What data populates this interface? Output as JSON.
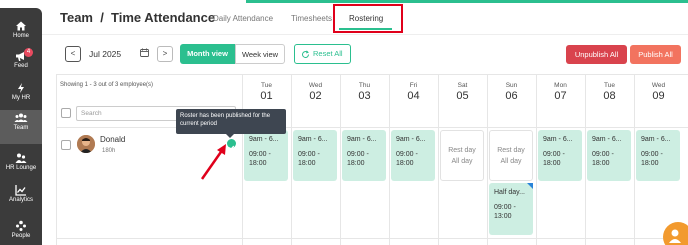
{
  "sidebar": {
    "items": [
      {
        "label": "Home",
        "icon": "home-icon"
      },
      {
        "label": "Feed",
        "icon": "megaphone-icon",
        "badge": "4"
      },
      {
        "label": "My HR",
        "icon": "lightning-icon"
      },
      {
        "label": "Team",
        "icon": "team-icon",
        "active": true
      },
      {
        "label": "HR Lounge",
        "icon": "lounge-icon"
      },
      {
        "label": "Analytics",
        "icon": "analytics-icon"
      },
      {
        "label": "People",
        "icon": "people-icon"
      }
    ]
  },
  "header": {
    "title": "Team  /  Time Attendance",
    "tabs": [
      {
        "label": "Daily Attendance"
      },
      {
        "label": "Timesheets"
      },
      {
        "label": "Rostering",
        "active": true
      }
    ]
  },
  "toolbar": {
    "prev": "<",
    "next": ">",
    "month": "Jul 2025",
    "month_view": "Month view",
    "week_view": "Week view",
    "reset_all": "Reset All",
    "unpublish_all": "Unpublish All",
    "publish_all": "Publish All"
  },
  "grid": {
    "showing": "Showing 1 - 3 out of 3 employee(s)",
    "search_placeholder": "Search",
    "days": [
      {
        "name": "Tue",
        "num": "01"
      },
      {
        "name": "Wed",
        "num": "02"
      },
      {
        "name": "Thu",
        "num": "03"
      },
      {
        "name": "Fri",
        "num": "04"
      },
      {
        "name": "Sat",
        "num": "05"
      },
      {
        "name": "Sun",
        "num": "06"
      },
      {
        "name": "Mon",
        "num": "07"
      },
      {
        "name": "Tue",
        "num": "08"
      },
      {
        "name": "Wed",
        "num": "09"
      }
    ],
    "employee": {
      "name": "Donald",
      "hours": "180h"
    },
    "shift_title": "9am - 6...",
    "shift_time": "09:00 -\n18:00",
    "rest_label": "Rest day\nAll day",
    "half_day_title": "Half day...",
    "half_day_time": "09:00 -\n13:00"
  },
  "tooltip": "Roster has been published for the current period",
  "colors": {
    "accent": "#2bbf8f",
    "shift_bg": "#cdeee2",
    "unpublish": "#d9434d",
    "publish": "#f2735f"
  }
}
